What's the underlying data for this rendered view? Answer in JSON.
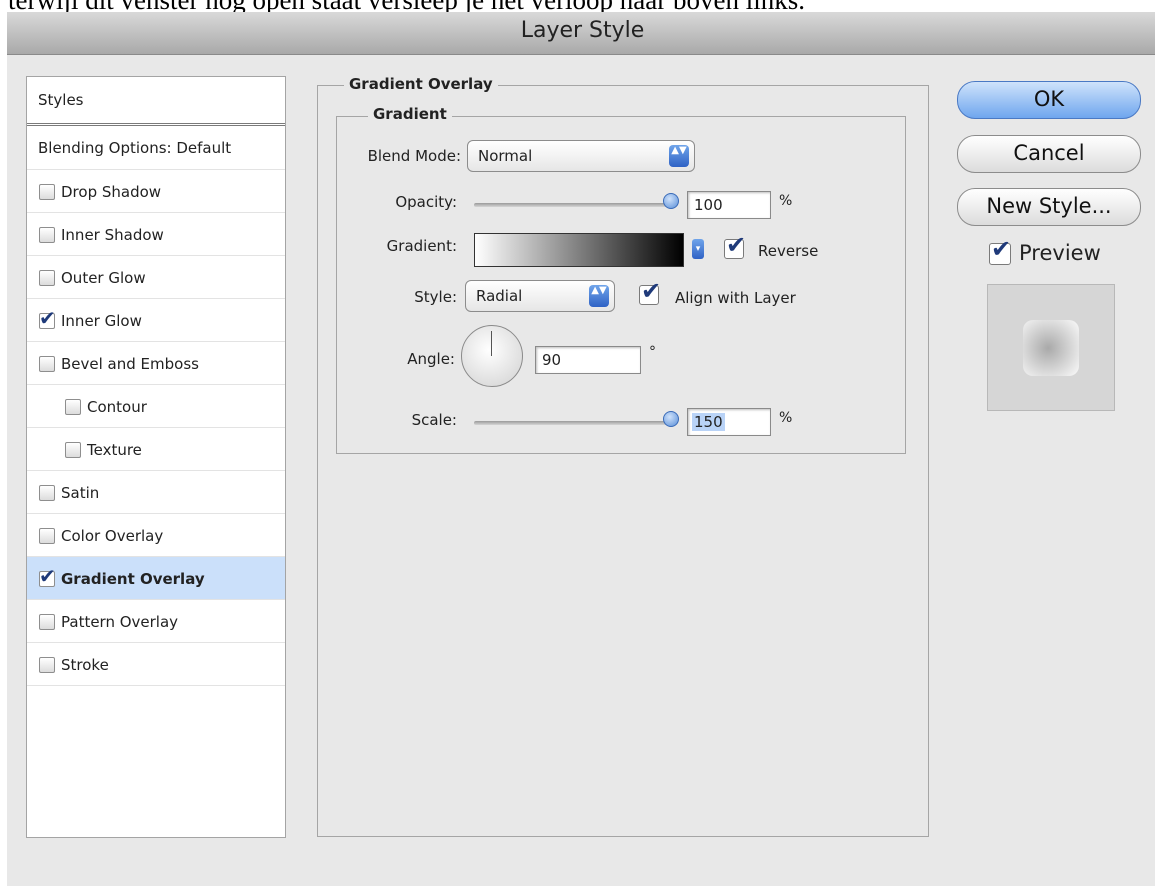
{
  "caption": "terwijl dit venster nog open staat versleep je het verloop naar boven links.",
  "window": {
    "title": "Layer Style"
  },
  "sidebar": {
    "header": "Styles",
    "blending": "Blending Options: Default",
    "items": [
      {
        "label": "Drop Shadow",
        "checked": false
      },
      {
        "label": "Inner Shadow",
        "checked": false
      },
      {
        "label": "Outer Glow",
        "checked": false
      },
      {
        "label": "Inner Glow",
        "checked": true
      },
      {
        "label": "Bevel and Emboss",
        "checked": false
      },
      {
        "label": "Contour",
        "checked": false
      },
      {
        "label": "Texture",
        "checked": false
      },
      {
        "label": "Satin",
        "checked": false
      },
      {
        "label": "Color Overlay",
        "checked": false
      },
      {
        "label": "Gradient Overlay",
        "checked": true
      },
      {
        "label": "Pattern Overlay",
        "checked": false
      },
      {
        "label": "Stroke",
        "checked": false
      }
    ]
  },
  "panel": {
    "group_title": "Gradient Overlay",
    "sub_title": "Gradient",
    "blend_mode_label": "Blend Mode:",
    "blend_mode_value": "Normal",
    "opacity_label": "Opacity:",
    "opacity_value": "100",
    "opacity_unit": "%",
    "gradient_label": "Gradient:",
    "reverse_label": "Reverse",
    "reverse_checked": true,
    "style_label": "Style:",
    "style_value": "Radial",
    "align_label": "Align with Layer",
    "align_checked": true,
    "angle_label": "Angle:",
    "angle_value": "90",
    "angle_unit": "°",
    "scale_label": "Scale:",
    "scale_value": "150",
    "scale_unit": "%"
  },
  "buttons": {
    "ok": "OK",
    "cancel": "Cancel",
    "new_style": "New Style..."
  },
  "preview": {
    "label": "Preview",
    "checked": true
  },
  "icons": {
    "checkmark": "✔",
    "popup_arrows": "▲▼",
    "dropdown_arrow": "▾"
  }
}
